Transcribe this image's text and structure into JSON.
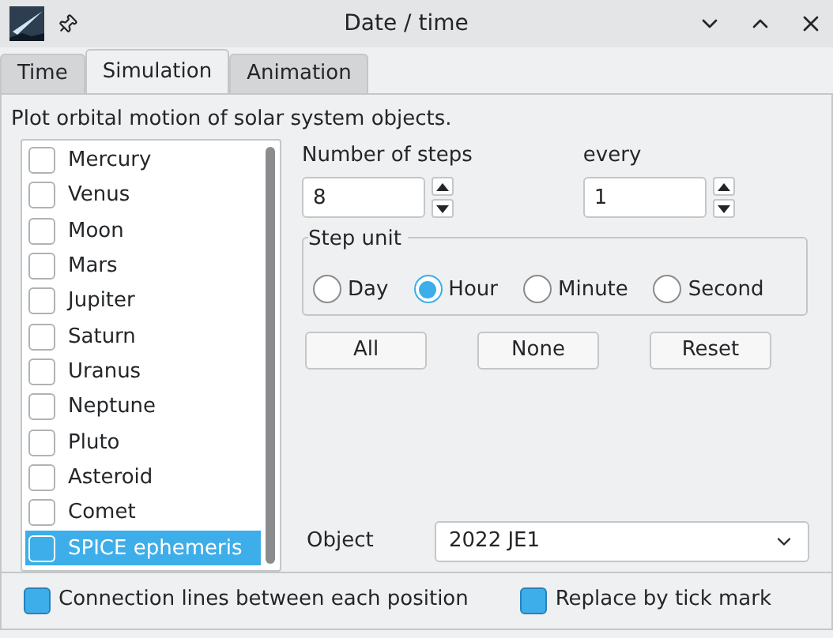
{
  "window": {
    "title": "Date / time"
  },
  "tabs": [
    {
      "label": "Time",
      "selected": false
    },
    {
      "label": "Simulation",
      "selected": true
    },
    {
      "label": "Animation",
      "selected": false
    }
  ],
  "description": "Plot orbital motion of solar system objects.",
  "objects": [
    {
      "label": "Mercury",
      "checked": false,
      "selected": false
    },
    {
      "label": "Venus",
      "checked": false,
      "selected": false
    },
    {
      "label": "Moon",
      "checked": false,
      "selected": false
    },
    {
      "label": "Mars",
      "checked": false,
      "selected": false
    },
    {
      "label": "Jupiter",
      "checked": false,
      "selected": false
    },
    {
      "label": "Saturn",
      "checked": false,
      "selected": false
    },
    {
      "label": "Uranus",
      "checked": false,
      "selected": false
    },
    {
      "label": "Neptune",
      "checked": false,
      "selected": false
    },
    {
      "label": "Pluto",
      "checked": false,
      "selected": false
    },
    {
      "label": "Asteroid",
      "checked": false,
      "selected": false
    },
    {
      "label": "Comet",
      "checked": false,
      "selected": false
    },
    {
      "label": "SPICE ephemeris",
      "checked": false,
      "selected": true
    }
  ],
  "steps": {
    "label": "Number of steps",
    "value": "8"
  },
  "every": {
    "label": "every",
    "value": "1"
  },
  "step_unit": {
    "title": "Step unit",
    "options": [
      {
        "label": "Day",
        "selected": false
      },
      {
        "label": "Hour",
        "selected": true
      },
      {
        "label": "Minute",
        "selected": false
      },
      {
        "label": "Second",
        "selected": false
      }
    ]
  },
  "buttons": [
    "All",
    "None",
    "Reset"
  ],
  "object": {
    "label": "Object",
    "value": "2022 JE1"
  },
  "options": [
    {
      "label": "Connection lines between each position",
      "checked": true
    },
    {
      "label": "Replace by tick mark",
      "checked": true
    }
  ]
}
